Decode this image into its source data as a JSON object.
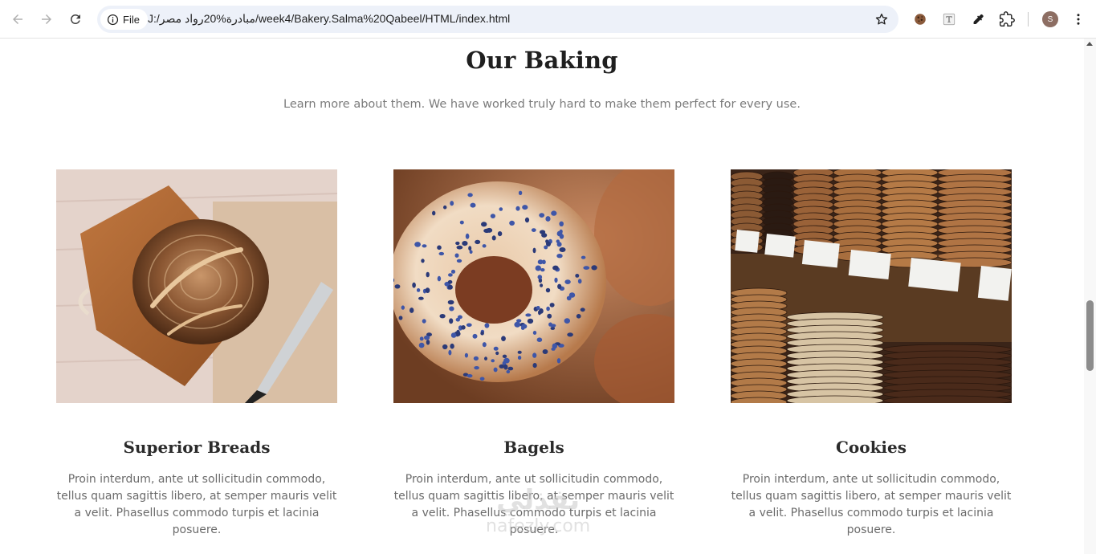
{
  "browser": {
    "site_chip_label": "File",
    "url": "J:/مبادرة%20رواد مصر/week4/Bakery.Salma%20Qabeel/HTML/index.html",
    "profile_initial": "S",
    "icons": [
      "back-icon",
      "forward-icon",
      "reload-icon",
      "info-icon",
      "star-icon",
      "cookie-extension-icon",
      "text-extension-icon",
      "eyedropper-extension-icon",
      "extensions-puzzle-icon",
      "menu-dots-icon"
    ]
  },
  "section": {
    "title": "Our Baking",
    "subtitle": "Learn more about them. We have worked truly hard to make them perfect for every use."
  },
  "cards": [
    {
      "title": "Superior Breads",
      "image": "sourdough bread loaf on wooden board",
      "description": "Proin interdum, ante ut sollicitudin commodo, tellus quam sagittis libero, at semper mauris velit a velit. Phasellus commodo turpis et lacinia posuere."
    },
    {
      "title": "Bagels",
      "image": "bagel with blue sprinkles",
      "description": "Proin interdum, ante ut sollicitudin commodo, tellus quam sagittis libero, at semper mauris velit a velit. Phasellus commodo turpis et lacinia posuere."
    },
    {
      "title": "Cookies",
      "image": "stacked cookies on display with price tags",
      "description": "Proin interdum, ante ut sollicitudin commodo, tellus quam sagittis libero, at semper mauris velit a velit. Phasellus commodo turpis et lacinia posuere."
    }
  ],
  "watermark": {
    "arabic": "نفذلي",
    "latin": "nafezly.com"
  },
  "colors": {
    "title": "#1f1f1f",
    "subtitle": "#7b7b7b",
    "body_text": "#6b6b6b",
    "omnibox": "#edf1f9"
  }
}
